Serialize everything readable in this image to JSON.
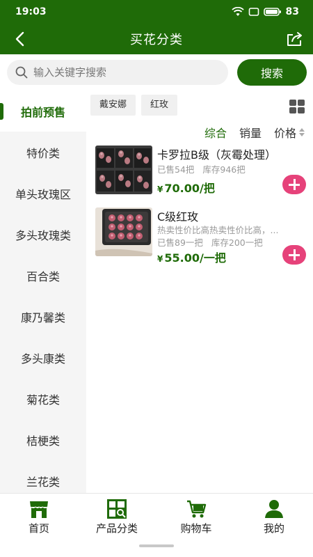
{
  "status_bar": {
    "time": "19:03",
    "battery": "83"
  },
  "header": {
    "title": "买花分类"
  },
  "search": {
    "placeholder": "输入关键字搜索",
    "button_label": "搜索"
  },
  "sidebar": {
    "items": [
      {
        "label": "拍前预售",
        "active": true
      },
      {
        "label": "特价类"
      },
      {
        "label": "单头玫瑰区"
      },
      {
        "label": "多头玫瑰类"
      },
      {
        "label": "百合类"
      },
      {
        "label": "康乃馨类"
      },
      {
        "label": "多头康类"
      },
      {
        "label": "菊花类"
      },
      {
        "label": "桔梗类"
      },
      {
        "label": "兰花类"
      }
    ]
  },
  "filters": {
    "tags": [
      "戴安娜",
      "红玫"
    ]
  },
  "sort": {
    "options": [
      "综合",
      "销量",
      "价格"
    ],
    "active": "综合"
  },
  "products": [
    {
      "name": "卡罗拉B级（灰霉处理）",
      "sold": "已售54把",
      "stock": "库存946把",
      "price": "70.00/把",
      "currency": "¥"
    },
    {
      "name": "C级红玫",
      "desc": "热卖性价比高热卖性价比高，...",
      "sold": "已售89一把",
      "stock": "库存200一把",
      "price": "55.00/一把",
      "currency": "¥"
    }
  ],
  "tabbar": {
    "tabs": [
      {
        "label": "首页",
        "icon": "storefront-icon"
      },
      {
        "label": "产品分类",
        "icon": "category-search-icon"
      },
      {
        "label": "购物车",
        "icon": "cart-icon"
      },
      {
        "label": "我的",
        "icon": "user-icon"
      }
    ]
  },
  "colors": {
    "brand_green": "#1f6b08",
    "add_pink": "#e6427a"
  }
}
